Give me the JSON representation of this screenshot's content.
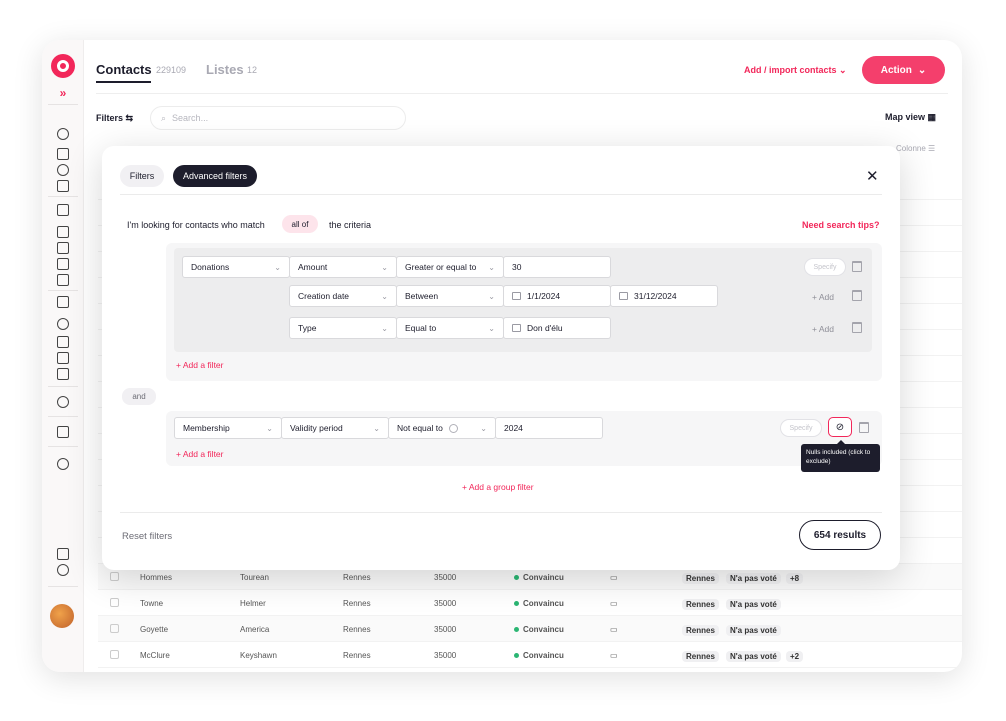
{
  "header": {
    "tab_contacts": "Contacts",
    "contacts_count": "229109",
    "tab_listes": "Listes",
    "listes_count": "12",
    "add_import": "Add / import contacts",
    "action": "Action"
  },
  "toolbar": {
    "filters": "Filters",
    "search_placeholder": "Search...",
    "map_view": "Map view",
    "colonne": "Colonne"
  },
  "table": {
    "rows": [
      {
        "last": "Hommes",
        "first": "Tourean",
        "city": "Rennes",
        "zip": "35000",
        "status": "Convaincu",
        "commune": "Rennes",
        "vote": "N'a pas voté",
        "extra": "+8"
      },
      {
        "last": "Towne",
        "first": "Helmer",
        "city": "Rennes",
        "zip": "35000",
        "status": "Convaincu",
        "commune": "Rennes",
        "vote": "N'a pas voté",
        "extra": ""
      },
      {
        "last": "Goyette",
        "first": "America",
        "city": "Rennes",
        "zip": "35000",
        "status": "Convaincu",
        "commune": "Rennes",
        "vote": "N'a pas voté",
        "extra": ""
      },
      {
        "last": "McClure",
        "first": "Keyshawn",
        "city": "Rennes",
        "zip": "35000",
        "status": "Convaincu",
        "commune": "Rennes",
        "vote": "N'a pas voté",
        "extra": "+2"
      }
    ]
  },
  "modal": {
    "tab_filters": "Filters",
    "tab_advanced": "Advanced filters",
    "criteria_prefix": "I'm looking for contacts who match",
    "criteria_match": "all of",
    "criteria_suffix": "the criteria",
    "tips": "Need search tips?",
    "group1": {
      "row1": {
        "field": "Donations",
        "sub": "Amount",
        "operator": "Greater or equal to",
        "value": "30",
        "specify": "Specify"
      },
      "row2": {
        "sub": "Creation date",
        "operator": "Between",
        "date_from": "1/1/2024",
        "date_to": "31/12/2024",
        "add": "+ Add"
      },
      "row3": {
        "sub": "Type",
        "operator": "Equal to",
        "value": "Don d'élu",
        "add": "+ Add"
      },
      "add_filter": "+ Add a filter"
    },
    "and_label": "and",
    "group2": {
      "row1": {
        "field": "Membership",
        "sub": "Validity period",
        "operator": "Not equal to",
        "value": "2024",
        "specify": "Specify"
      },
      "add_filter": "+ Add a filter",
      "tooltip": "Nulls included (click to exclude)"
    },
    "add_group": "+ Add a group filter",
    "reset": "Reset filters",
    "results": "654 results"
  },
  "colors": {
    "accent": "#f2275a",
    "dark": "#1d1d2c"
  }
}
